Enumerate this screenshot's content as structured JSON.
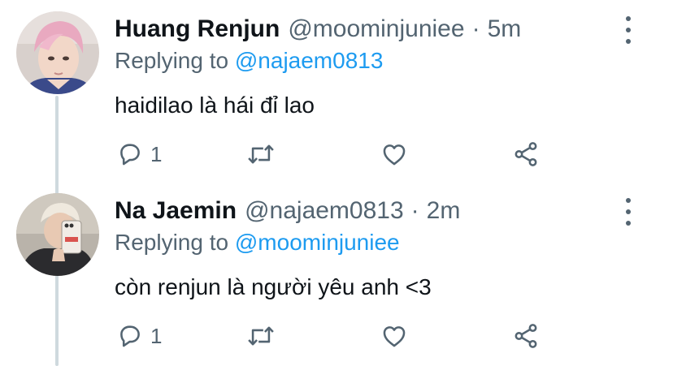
{
  "tweets": [
    {
      "name": "Huang Renjun",
      "handle": "@moominjuniee",
      "separator": "·",
      "time": "5m",
      "reply_prefix": "Replying to",
      "reply_to": "@najaem0813",
      "text": "haidilao là hái đỉ lao",
      "reply_count": "1",
      "avatar": "avatar-photo-pink-hair"
    },
    {
      "name": "Na Jaemin",
      "handle": "@najaem0813",
      "separator": "·",
      "time": "2m",
      "reply_prefix": "Replying to",
      "reply_to": "@moominjuniee",
      "text": "còn renjun là người yêu anh <3",
      "reply_count": "1",
      "avatar": "avatar-photo-mirror-selfie"
    }
  ],
  "icons": {
    "reply": "reply-icon",
    "retweet": "retweet-icon",
    "like": "like-icon",
    "share": "share-icon",
    "more": "more-options-icon"
  },
  "colors": {
    "name": "#0f1419",
    "secondary": "#536471",
    "mention": "#1d9bf0",
    "thread_line": "#cfd9de"
  }
}
